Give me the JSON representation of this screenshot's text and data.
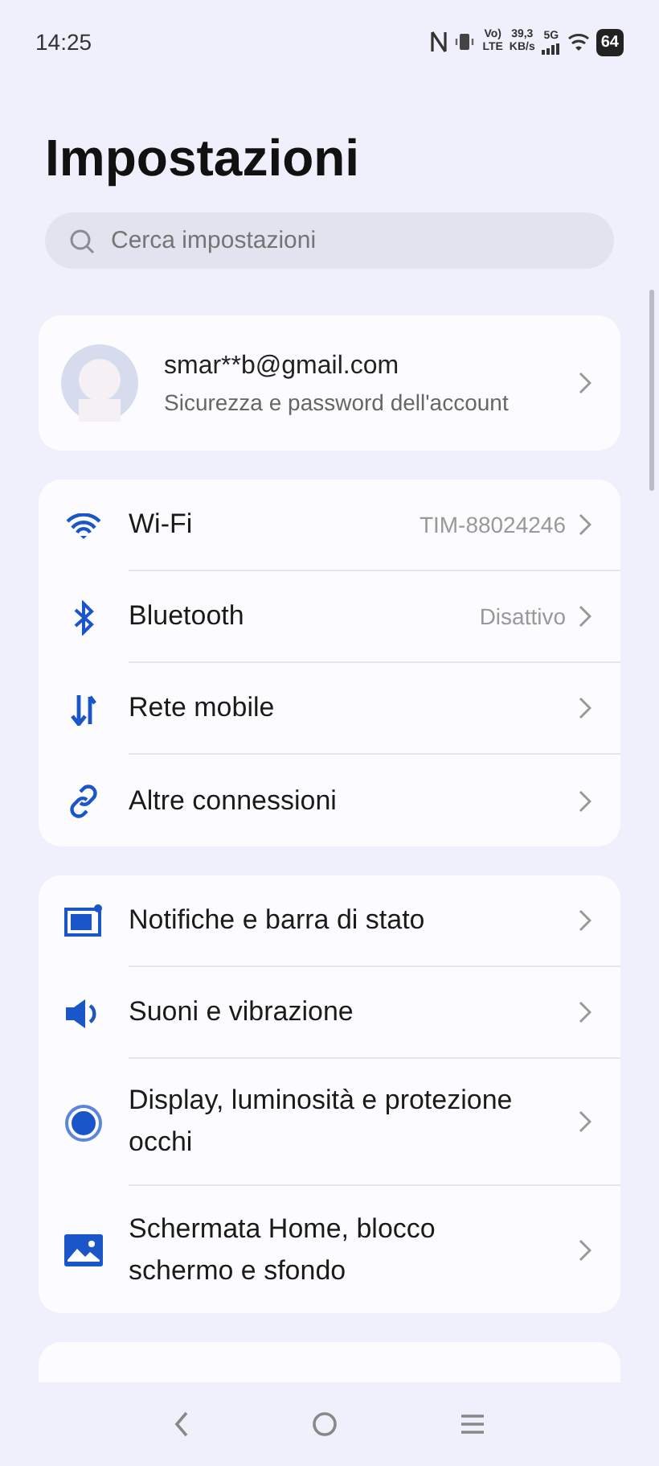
{
  "status_bar": {
    "time": "14:25",
    "volte_top": "Vo)",
    "volte_bottom": "LTE",
    "speed_value": "39,3",
    "speed_unit": "KB/s",
    "network": "5G",
    "battery": "64"
  },
  "title": "Impostazioni",
  "search": {
    "placeholder": "Cerca impostazioni"
  },
  "account": {
    "email": "smar**b@gmail.com",
    "subtitle": "Sicurezza e password dell'account"
  },
  "groups": [
    {
      "items": [
        {
          "label": "Wi-Fi",
          "value": "TIM-88024246"
        },
        {
          "label": "Bluetooth",
          "value": "Disattivo"
        },
        {
          "label": "Rete mobile"
        },
        {
          "label": "Altre connessioni"
        }
      ]
    },
    {
      "items": [
        {
          "label": "Notifiche e barra di stato"
        },
        {
          "label": "Suoni e vibrazione"
        },
        {
          "label": "Display, luminosità e protezione occhi"
        },
        {
          "label": "Schermata Home, blocco schermo e sfondo"
        }
      ]
    }
  ]
}
